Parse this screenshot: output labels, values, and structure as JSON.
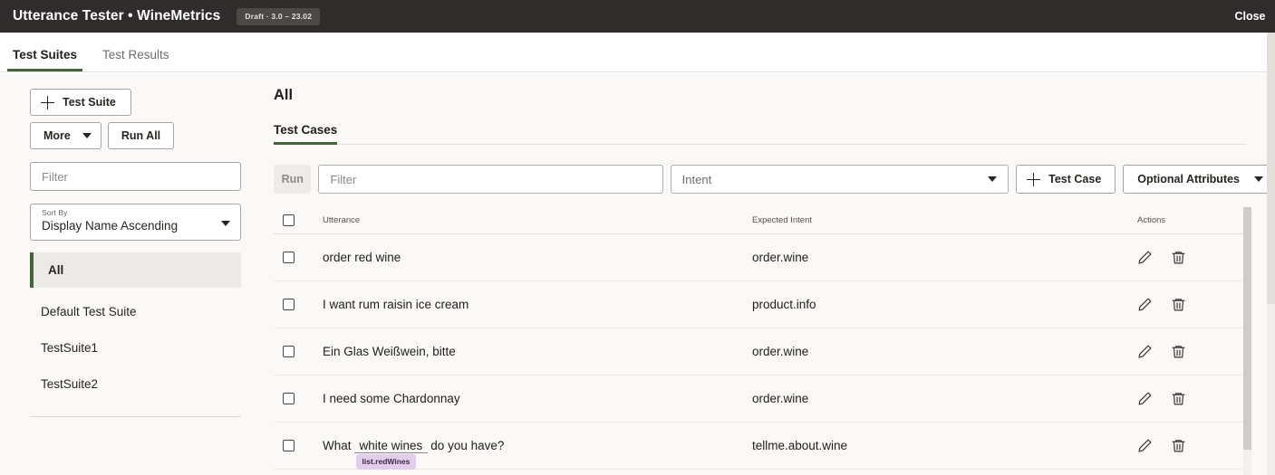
{
  "topbar": {
    "title": "Utterance Tester • WineMetrics",
    "badge": "Draft · 3.0 – 23.02",
    "close_label": "Close",
    "bg_color": "#2f2c2b"
  },
  "main_tabs": [
    {
      "label": "Test Suites",
      "active": true
    },
    {
      "label": "Test Results",
      "active": false
    }
  ],
  "sidebar": {
    "add_suite_label": "Test Suite",
    "more_label": "More",
    "run_all_label": "Run All",
    "filter_placeholder": "Filter",
    "filter_value": "",
    "sort": {
      "label": "Sort By",
      "value": "Display Name Ascending"
    },
    "suites": [
      {
        "label": "All",
        "active": true
      },
      {
        "label": "Default Test Suite",
        "active": false
      },
      {
        "label": "TestSuite1",
        "active": false
      },
      {
        "label": "TestSuite2",
        "active": false
      }
    ]
  },
  "content": {
    "page_title": "All",
    "sub_tabs": [
      {
        "label": "Test Cases",
        "active": true
      }
    ],
    "toolbar": {
      "run_label": "Run",
      "run_disabled": true,
      "filter_placeholder": "Filter",
      "filter_value": "",
      "intent_placeholder": "Intent",
      "add_test_case_label": "Test Case",
      "optional_attributes_label": "Optional Attributes"
    },
    "table": {
      "columns": [
        "Utterance",
        "Expected Intent",
        "Actions"
      ],
      "rows": [
        {
          "utterance": "order red wine",
          "expected_intent": "order.wine",
          "checked": false
        },
        {
          "utterance": "I want rum raisin ice cream",
          "expected_intent": "product.info",
          "checked": false
        },
        {
          "utterance": "Ein Glas Weißwein, bitte",
          "expected_intent": "order.wine",
          "checked": false
        },
        {
          "utterance": "I need some Chardonnay",
          "expected_intent": "order.wine",
          "checked": false
        },
        {
          "utterance_prefix": "What",
          "annotated_text": "white wines",
          "annotation_tag": "list.redWines",
          "utterance_suffix": "do you have?",
          "expected_intent": "tellme.about.wine",
          "checked": false
        }
      ]
    }
  },
  "colors": {
    "accent_green": "#44653c",
    "annotation_bg": "#e3cdec",
    "header_dark": "#2f2c2b",
    "page_bg": "#faf9f7"
  }
}
